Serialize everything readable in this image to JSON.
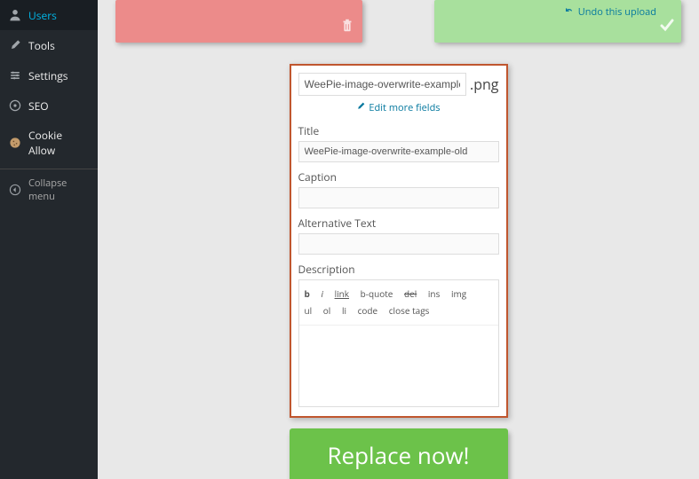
{
  "sidebar": {
    "items": [
      {
        "label": "Users"
      },
      {
        "label": "Tools"
      },
      {
        "label": "Settings"
      },
      {
        "label": "SEO"
      },
      {
        "label": "Cookie Allow"
      }
    ],
    "collapse": "Collapse menu"
  },
  "green_card": {
    "undo_label": "Undo this upload"
  },
  "panel": {
    "filename_value": "WeePie-image-overwrite-example-o",
    "extension": ".png",
    "edit_more": "Edit more fields",
    "title_label": "Title",
    "title_value": "WeePie-image-overwrite-example-old",
    "caption_label": "Caption",
    "caption_value": "",
    "alt_label": "Alternative Text",
    "alt_value": "",
    "desc_label": "Description",
    "desc_value": "",
    "quicktags": {
      "b": "b",
      "i": "i",
      "link": "link",
      "bquote": "b-quote",
      "del": "del",
      "ins": "ins",
      "img": "img",
      "ul": "ul",
      "ol": "ol",
      "li": "li",
      "code": "code",
      "close": "close tags"
    }
  },
  "replace_btn": "Replace now!"
}
